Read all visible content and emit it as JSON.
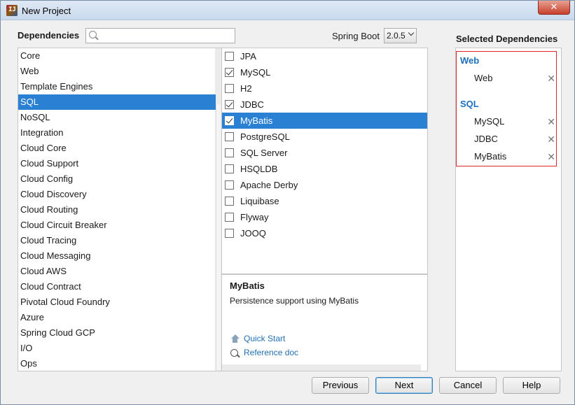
{
  "window": {
    "title": "New Project",
    "app_icon_text": "IJ",
    "close_glyph": "✕"
  },
  "header": {
    "dependencies_label": "Dependencies",
    "search": {
      "value": "",
      "placeholder": ""
    },
    "spring_boot_label": "Spring Boot",
    "spring_boot_version": "2.0.5"
  },
  "categories": [
    "Core",
    "Web",
    "Template Engines",
    "SQL",
    "NoSQL",
    "Integration",
    "Cloud Core",
    "Cloud Support",
    "Cloud Config",
    "Cloud Discovery",
    "Cloud Routing",
    "Cloud Circuit Breaker",
    "Cloud Tracing",
    "Cloud Messaging",
    "Cloud AWS",
    "Cloud Contract",
    "Pivotal Cloud Foundry",
    "Azure",
    "Spring Cloud GCP",
    "I/O",
    "Ops"
  ],
  "selected_category": "SQL",
  "dependencies": [
    {
      "label": "JPA",
      "checked": false
    },
    {
      "label": "MySQL",
      "checked": true
    },
    {
      "label": "H2",
      "checked": false
    },
    {
      "label": "JDBC",
      "checked": true
    },
    {
      "label": "MyBatis",
      "checked": true,
      "selected": true
    },
    {
      "label": "PostgreSQL",
      "checked": false
    },
    {
      "label": "SQL Server",
      "checked": false
    },
    {
      "label": "HSQLDB",
      "checked": false
    },
    {
      "label": "Apache Derby",
      "checked": false
    },
    {
      "label": "Liquibase",
      "checked": false
    },
    {
      "label": "Flyway",
      "checked": false
    },
    {
      "label": "JOOQ",
      "checked": false
    }
  ],
  "description": {
    "title": "MyBatis",
    "text": "Persistence support using MyBatis",
    "quick_start": "Quick Start",
    "reference_doc": "Reference doc"
  },
  "selected_panel": {
    "title": "Selected Dependencies",
    "groups": [
      {
        "name": "Web",
        "items": [
          "Web"
        ]
      },
      {
        "name": "SQL",
        "items": [
          "MySQL",
          "JDBC",
          "MyBatis"
        ]
      }
    ],
    "remove_glyph": "✕"
  },
  "buttons": {
    "previous": "Previous",
    "next": "Next",
    "cancel": "Cancel",
    "help": "Help"
  },
  "colors": {
    "selection": "#2a80d2",
    "group_title": "#1d6fbd",
    "highlight_border": "#e0282a",
    "link": "#2470b3"
  }
}
